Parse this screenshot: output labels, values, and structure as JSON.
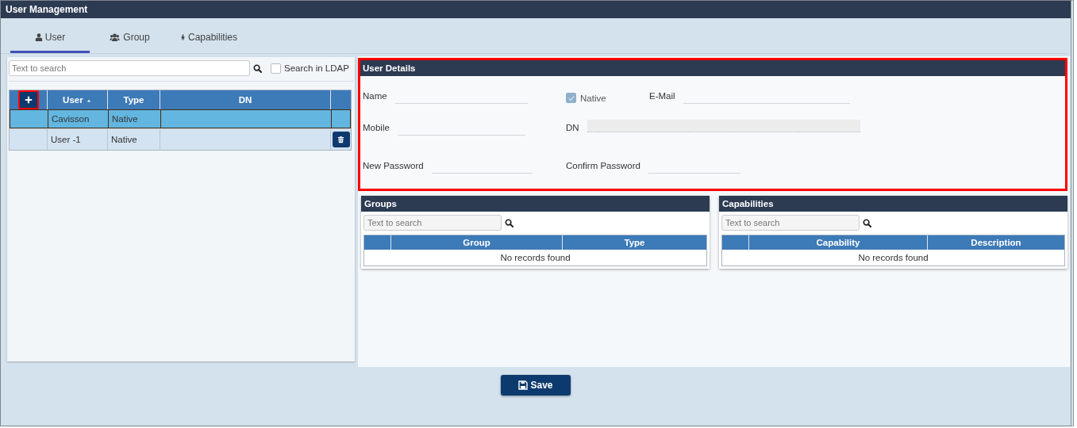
{
  "window": {
    "title": "User Management"
  },
  "tabs": [
    {
      "label": "User",
      "selected": true
    },
    {
      "label": "Group",
      "selected": false
    },
    {
      "label": "Capabilities",
      "selected": false
    }
  ],
  "user_list": {
    "search": {
      "placeholder": "Text to search"
    },
    "ldap_filter": {
      "label": "Search in LDAP",
      "checked": false
    },
    "add_highlighted": true,
    "columns": [
      {
        "label": "User",
        "sorted": true
      },
      {
        "label": "Type",
        "sorted": false
      },
      {
        "label": "DN",
        "sorted": false
      }
    ],
    "rows": [
      {
        "user": "Cavisson",
        "type": "Native",
        "selected": true,
        "deletable": false
      },
      {
        "user": "User -1",
        "type": "Native",
        "selected": false,
        "deletable": true
      }
    ]
  },
  "user_details": {
    "title": "User Details",
    "highlighted": true,
    "rows": [
      {
        "fields": [
          {
            "kind": "text",
            "label": "Name"
          },
          {
            "kind": "checkbox",
            "label": "Native",
            "checked": true,
            "disabled": true
          },
          {
            "kind": "text",
            "label": "E-Mail"
          }
        ]
      },
      {
        "fields": [
          {
            "kind": "text",
            "label": "Mobile"
          },
          {
            "kind": "readonly",
            "label": "DN"
          }
        ]
      },
      {
        "fields": [
          {
            "kind": "password",
            "label": "New Password"
          },
          {
            "kind": "password",
            "label": "Confirm Password"
          }
        ]
      }
    ]
  },
  "groups": {
    "title": "Groups",
    "search": {
      "placeholder": "Text to search"
    },
    "columns": [
      "Group",
      "Type"
    ],
    "empty_message": "No records found"
  },
  "capabilities": {
    "title": "Capabilities",
    "search": {
      "placeholder": "Text to search"
    },
    "columns": [
      "Capability",
      "Description"
    ],
    "empty_message": "No records found"
  },
  "save_button": {
    "label": "Save"
  }
}
